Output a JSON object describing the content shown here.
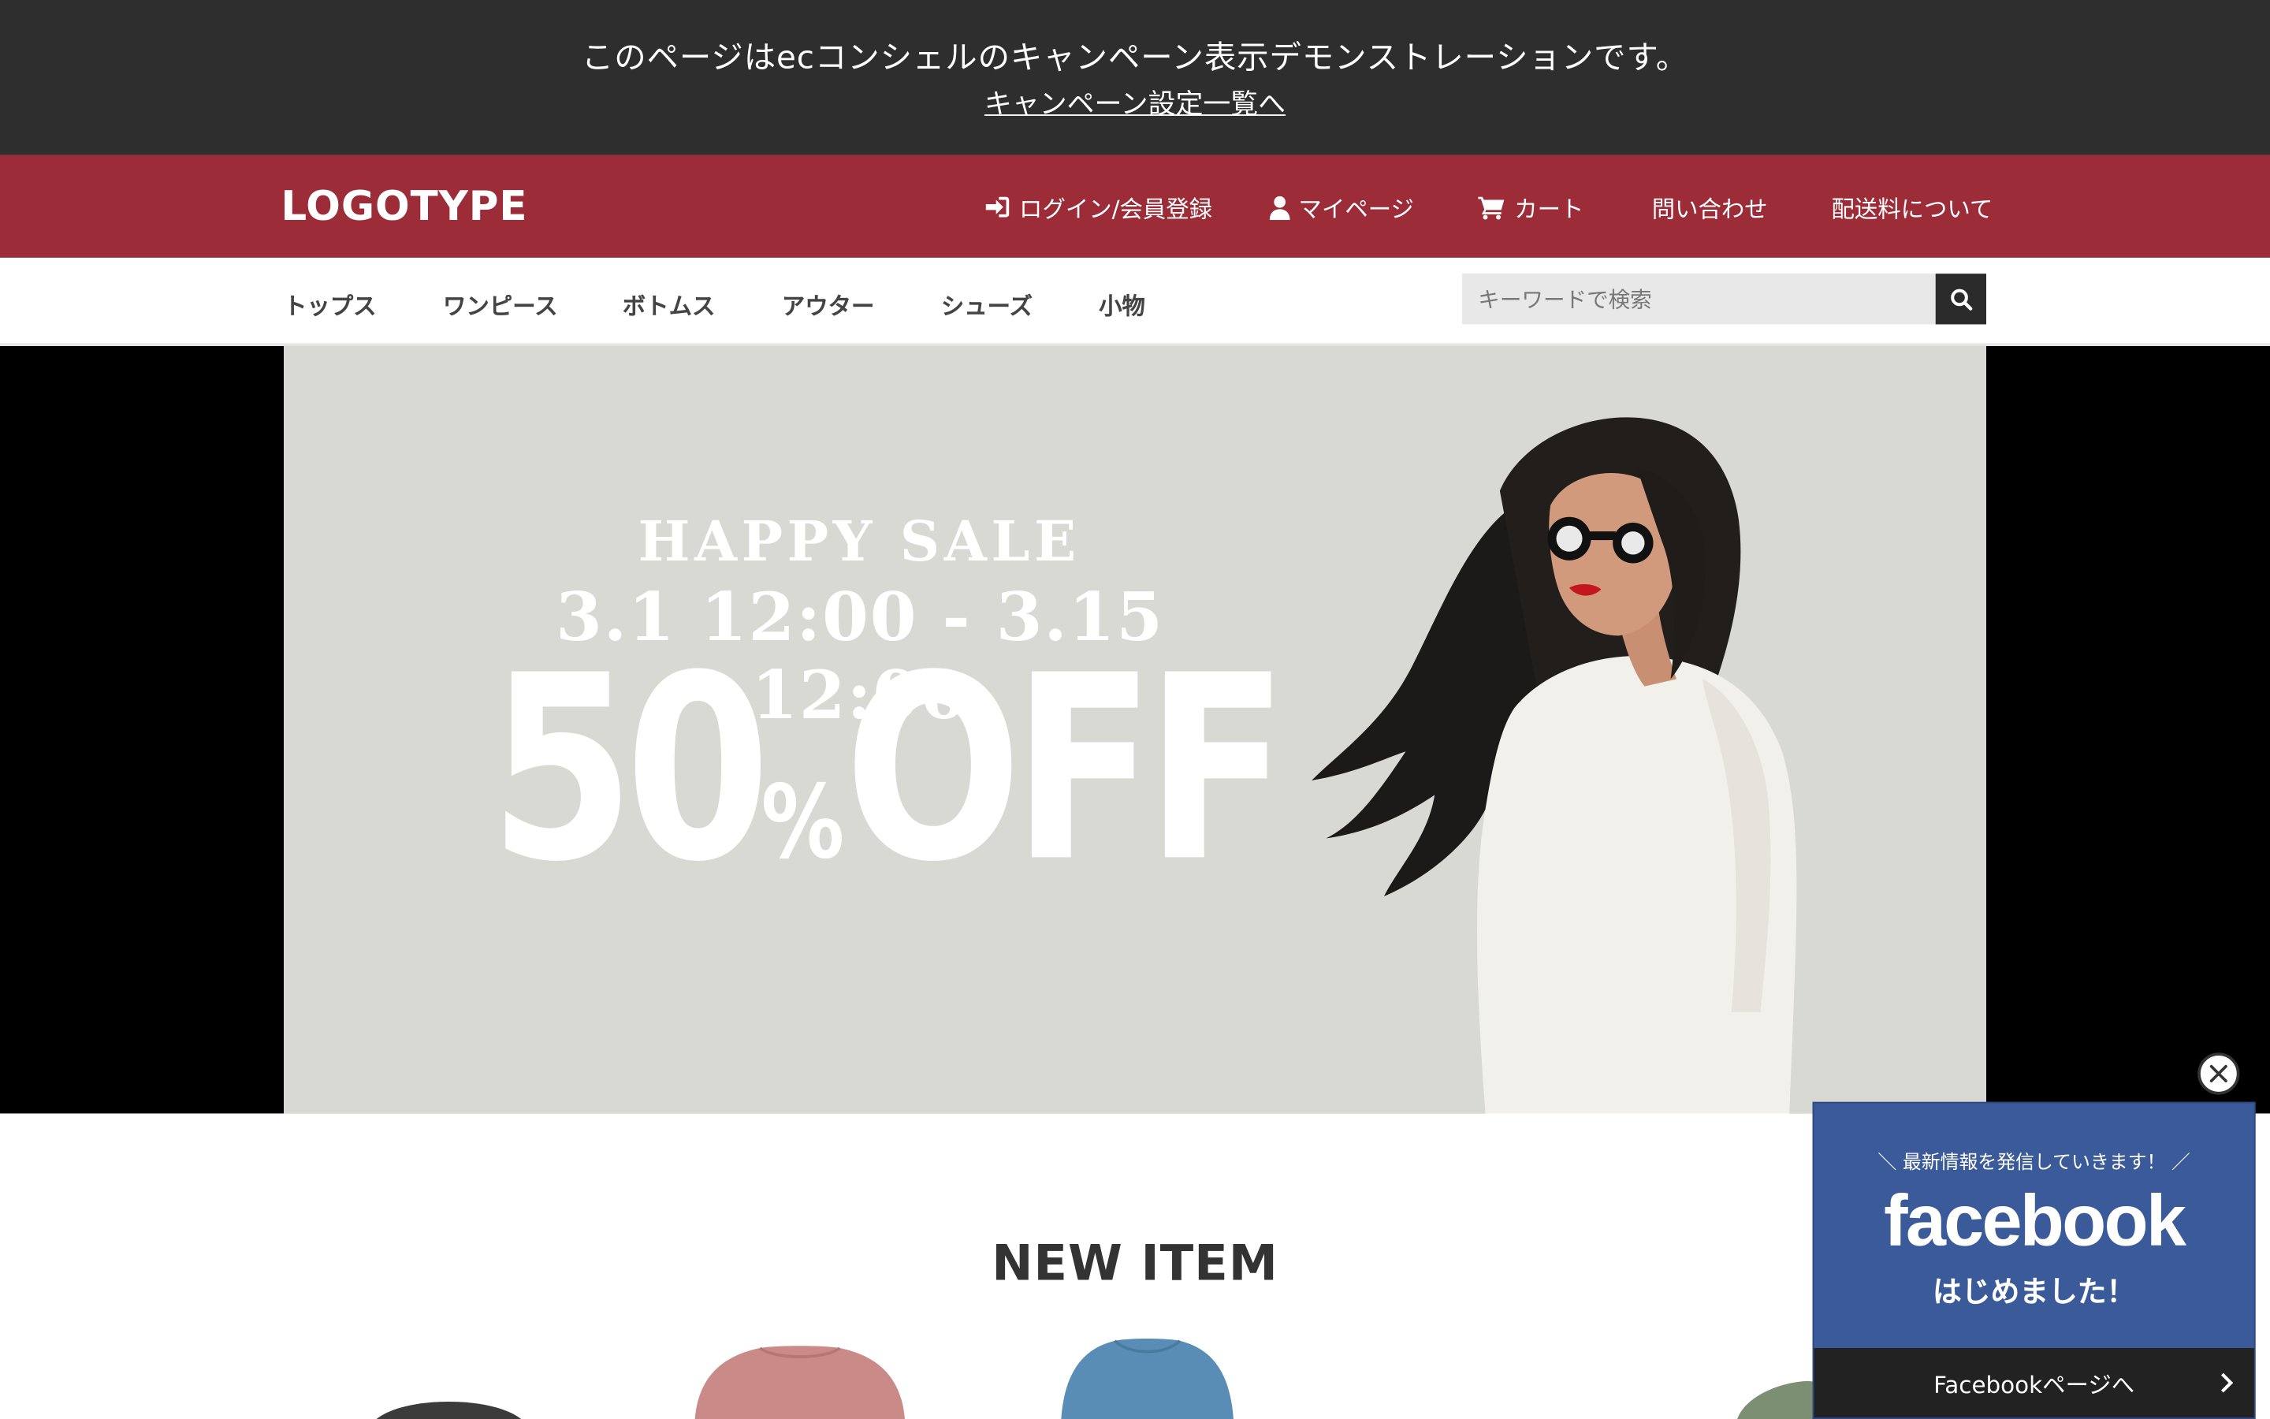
{
  "demo_bar": {
    "text": "このページはecコンシェルのキャンペーン表示デモンストレーションです。",
    "link": "キャンペーン設定一覧へ"
  },
  "header": {
    "logo": "LOGOTYPE",
    "nav": {
      "login": "ログイン/会員登録",
      "mypage": "マイページ",
      "cart": "カート",
      "contact": "問い合わせ",
      "shipping": "配送料について"
    }
  },
  "categories": [
    "トップス",
    "ワンピース",
    "ボトムス",
    "アウター",
    "シューズ",
    "小物"
  ],
  "search": {
    "placeholder": "キーワードで検索"
  },
  "banner": {
    "happy": "HAPPY SALE",
    "dates": "3.1 12:00 - 3.15 12:00",
    "discount_num": "50",
    "discount_pct": "%",
    "discount_off": "OFF"
  },
  "section": {
    "new_item": "NEW ITEM"
  },
  "facebook_popup": {
    "latest": "最新情報を発信していきます！",
    "logo": "facebook",
    "started": "はじめました！",
    "link": "Facebookページへ"
  },
  "colors": {
    "demo_bar_bg": "#2e2e2e",
    "header_bg": "#9c2c37",
    "banner_bg": "#d8d9d3",
    "facebook_blue": "#3b5a9a"
  }
}
